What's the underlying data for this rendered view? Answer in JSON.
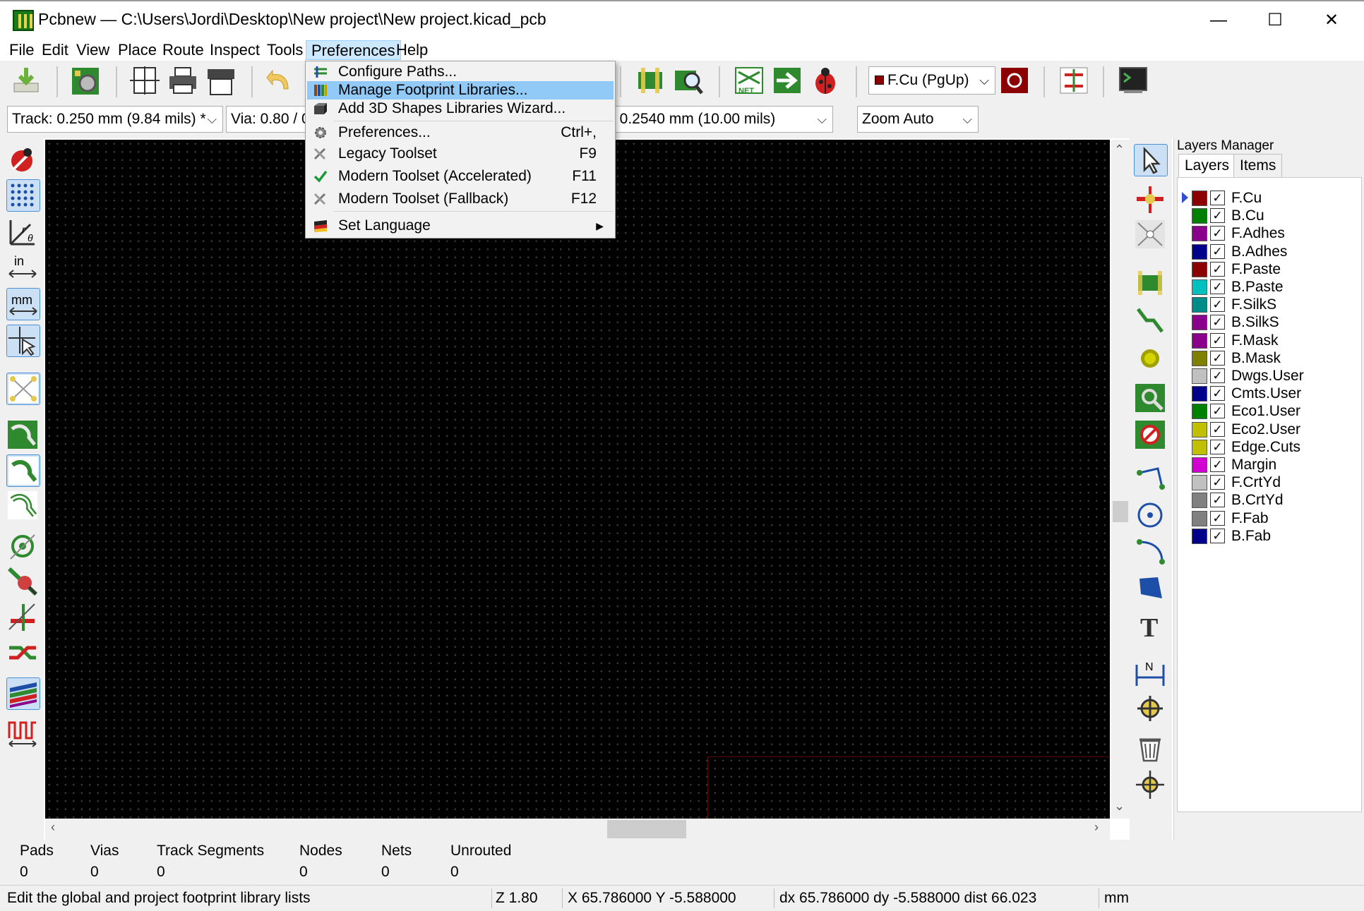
{
  "window": {
    "title": "Pcbnew — C:\\Users\\Jordi\\Desktop\\New project\\New project.kicad_pcb",
    "minimize_glyph": "—",
    "maximize_glyph": "☐",
    "close_glyph": "✕"
  },
  "menubar": {
    "items": [
      {
        "label": "File"
      },
      {
        "label": "Edit"
      },
      {
        "label": "View"
      },
      {
        "label": "Place"
      },
      {
        "label": "Route"
      },
      {
        "label": "Inspect"
      },
      {
        "label": "Tools"
      },
      {
        "label": "Preferences",
        "active": true
      },
      {
        "label": "Help"
      }
    ]
  },
  "preferences_menu": {
    "items": [
      {
        "label": "Configure Paths...",
        "shortcut": "",
        "icon": "folder-path-icon"
      },
      {
        "label": "Manage Footprint Libraries...",
        "shortcut": "",
        "icon": "library-icon",
        "highlighted": true
      },
      {
        "label": "Add 3D Shapes Libraries Wizard...",
        "shortcut": "",
        "icon": "3d-shapes-icon"
      },
      {
        "label": "Preferences...",
        "shortcut": "Ctrl+,",
        "icon": "gear-icon"
      },
      {
        "label": "Legacy Toolset",
        "shortcut": "F9",
        "icon": "tools-icon"
      },
      {
        "label": "Modern Toolset (Accelerated)",
        "shortcut": "F11",
        "icon": "checkmark-icon"
      },
      {
        "label": "Modern Toolset (Fallback)",
        "shortcut": "F12",
        "icon": "tools-icon"
      },
      {
        "label": "Set Language",
        "shortcut": "",
        "icon": "flag-icon",
        "submenu_glyph": "▶"
      }
    ]
  },
  "options_bar": {
    "track_width": "Track: 0.250 mm (9.84 mils) *",
    "via_size": "Via: 0.80 / 0",
    "grid": ": 0.2540 mm (10.00 mils)",
    "zoom": "Zoom Auto",
    "active_layer": "F.Cu (PgUp)",
    "chevron": "⌵"
  },
  "layers_manager": {
    "title": "Layers Manager",
    "tabs": [
      "Layers",
      "Items"
    ],
    "check_glyph": "✓",
    "layers": [
      {
        "name": "F.Cu",
        "color": "#8b0000",
        "active": true
      },
      {
        "name": "B.Cu",
        "color": "#008000"
      },
      {
        "name": "F.Adhes",
        "color": "#8b008b"
      },
      {
        "name": "B.Adhes",
        "color": "#00008b"
      },
      {
        "name": "F.Paste",
        "color": "#8b0000"
      },
      {
        "name": "B.Paste",
        "color": "#00c0c0"
      },
      {
        "name": "F.SilkS",
        "color": "#008b8b"
      },
      {
        "name": "B.SilkS",
        "color": "#8b008b"
      },
      {
        "name": "F.Mask",
        "color": "#8b008b"
      },
      {
        "name": "B.Mask",
        "color": "#808000"
      },
      {
        "name": "Dwgs.User",
        "color": "#c0c0c0"
      },
      {
        "name": "Cmts.User",
        "color": "#00008b"
      },
      {
        "name": "Eco1.User",
        "color": "#008000"
      },
      {
        "name": "Eco2.User",
        "color": "#c0c000"
      },
      {
        "name": "Edge.Cuts",
        "color": "#c0c000"
      },
      {
        "name": "Margin",
        "color": "#d000d0"
      },
      {
        "name": "F.CrtYd",
        "color": "#c0c0c0"
      },
      {
        "name": "B.CrtYd",
        "color": "#808080"
      },
      {
        "name": "F.Fab",
        "color": "#808080"
      },
      {
        "name": "B.Fab",
        "color": "#00008b"
      }
    ]
  },
  "board_stats": [
    {
      "label": "Pads",
      "value": "0"
    },
    {
      "label": "Vias",
      "value": "0"
    },
    {
      "label": "Track Segments",
      "value": "0"
    },
    {
      "label": "Nodes",
      "value": "0"
    },
    {
      "label": "Nets",
      "value": "0"
    },
    {
      "label": "Unrouted",
      "value": "0"
    }
  ],
  "statusbar": {
    "message": "Edit the global and project footprint library lists",
    "zoom": "Z 1.80",
    "xy": "X 65.786000  Y -5.588000",
    "delta": "dx 65.786000  dy -5.588000  dist 66.023",
    "units": "mm"
  },
  "scrollbars": {
    "up": "⌃",
    "down": "⌄",
    "left": "‹",
    "right": "›"
  }
}
